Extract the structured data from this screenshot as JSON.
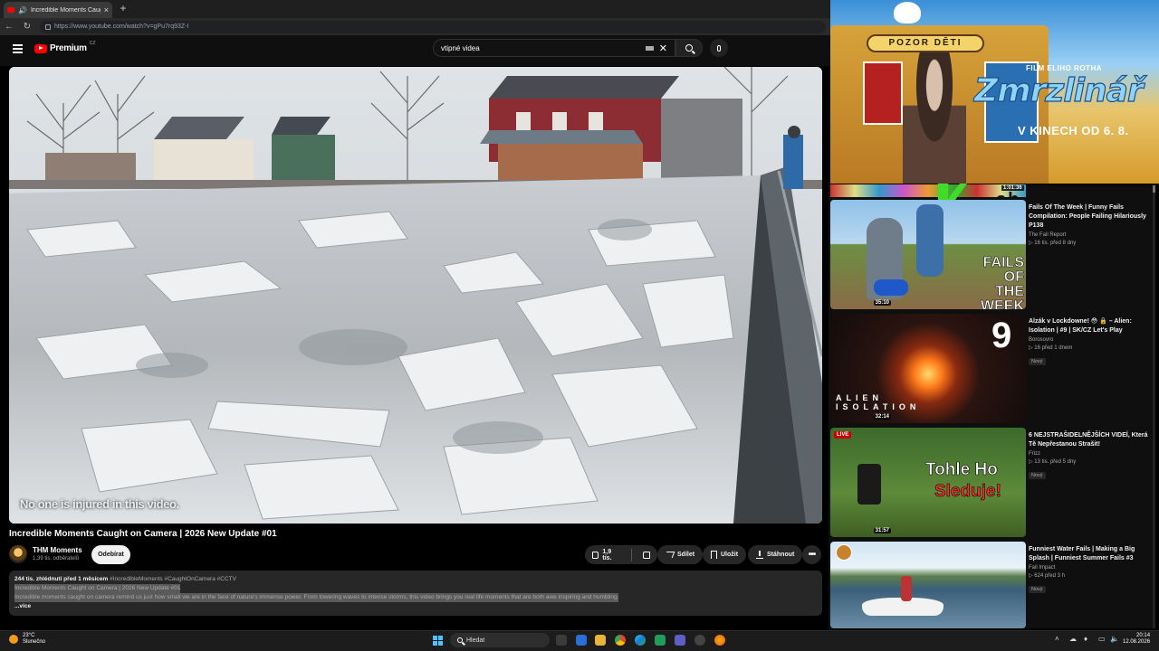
{
  "browser": {
    "tab_title": "Incredible Moments Caught on Camera",
    "url": "https://www.youtube.com/watch?v=gPu7rq93Z-I"
  },
  "youtube": {
    "logo_text": "Premium",
    "logo_cc": "CZ",
    "search_query": "vtipné videa"
  },
  "video": {
    "overlay_caption": "No one is injured in this video.",
    "title": "Incredible Moments Caught on Camera | 2026 New Update #01",
    "channel_name": "THM Moments",
    "channel_subs": "1,39 tis. odběratelů",
    "subscribe_label": "Odebírat",
    "likes": "1,9 tis.",
    "share_label": "Sdílet",
    "save_label": "Uložit",
    "download_label": "Stáhnout",
    "more_label": "•••"
  },
  "description": {
    "views_date": "244 tis. zhlédnutí  před 1 měsícem",
    "tags": "#IncredibleMoments #CaughtOnCamera #CCTV",
    "line1": "Incredible Moments Caught on Camera | 2026 New Update #01",
    "line2": "Incredible moments caught on camera remind us just how small we are in the face of nature's immense power. From towering waves to intense storms, this video brings you real life moments that are both awe inspiring and humbling.",
    "more": "...více"
  },
  "ad": {
    "sign": "POZOR DĚTI",
    "film_label": "FILM ELIHO ROTHA",
    "movie_title": "Zmrzlinář",
    "release": "V KINECH OD 6. 8."
  },
  "sidebar": {
    "strip_duration": "1:01:36",
    "strip_text": "sh",
    "items": [
      {
        "title": "Fails Of The Week | Funny Fails Compilation: People Failing Hilariously P138",
        "channel": "The Fail Report",
        "meta": "▷ 16 tis.  před 8 dny",
        "duration": "35:10",
        "badge": "",
        "thumb_text": "FAILS OF THE WEEK"
      },
      {
        "title": "Alzák v Lockdowne! 😳 🔒 – Alien: Isolation | #9 | SK/CZ Let's Play",
        "channel": "Borosovro",
        "meta": "▷ 16  před 1 dnem",
        "duration": "32:14",
        "badge": "Nový",
        "thumb_text": "ALIEN ISOLATION",
        "thumb_num": "9"
      },
      {
        "title": "6 NEJSTRAŠIDELNĚJŠÍCH VIDEÍ, Která Tě Nepřestanou Strašit!",
        "channel": "Frizz",
        "meta": "▷ 13 tis.  před 5 dny",
        "duration": "31:57",
        "badge": "Nový",
        "live": "LIVE",
        "thumb_text1": "Tohle Ho",
        "thumb_text2": "Sleduje!"
      },
      {
        "title": "Funniest Water Fails | Making a Big Splash | Funniest Summer Fails #3",
        "channel": "Fail Impact",
        "meta": "▷ 624  před 3 h",
        "badge": "Nový"
      }
    ]
  },
  "taskbar": {
    "temp": "23°C",
    "weather": "Slunečno",
    "search": "Hledat",
    "time": "20:14",
    "date": "12.08.2026"
  },
  "colors": {
    "yt_red": "#ff0000",
    "bg": "#0f0f0f",
    "pill": "#272727"
  }
}
